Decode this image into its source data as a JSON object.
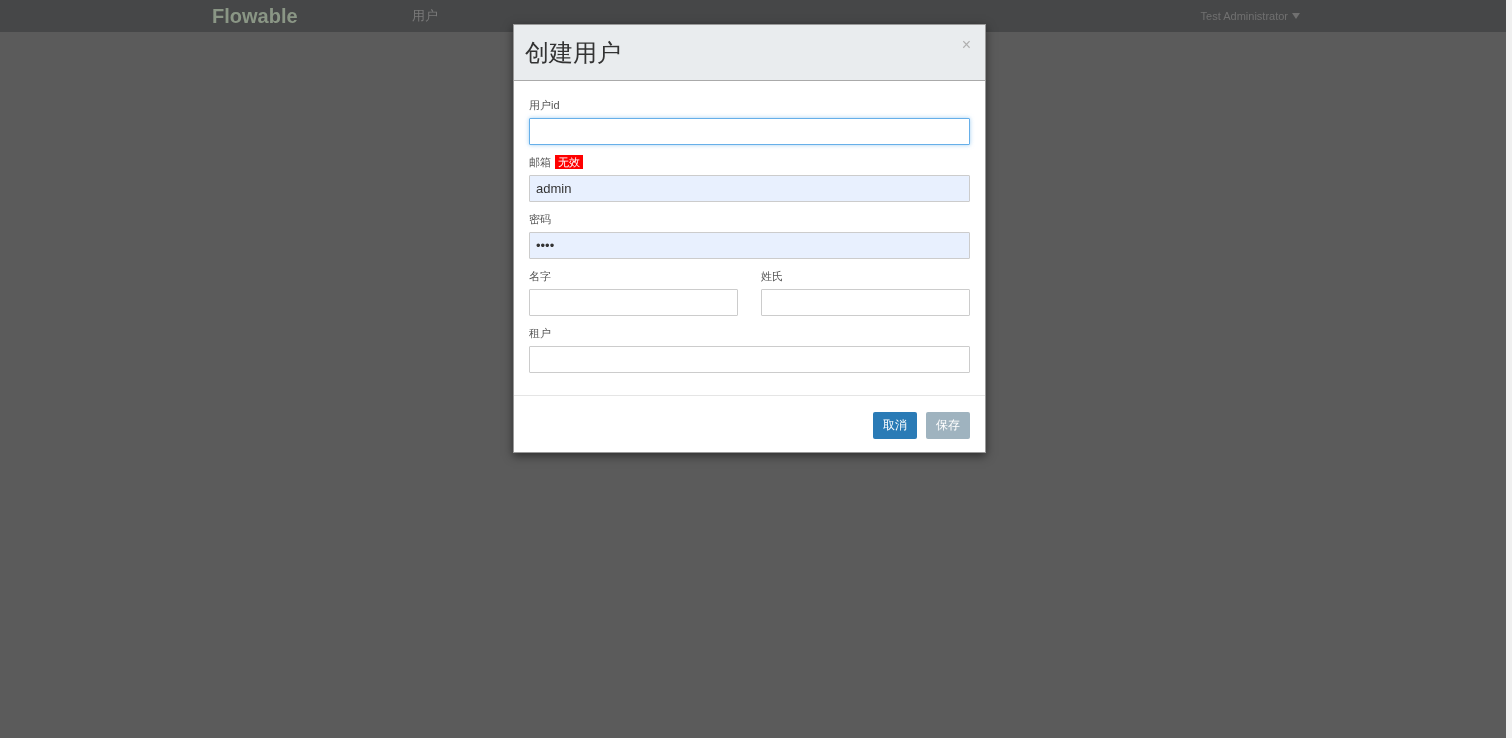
{
  "navbar": {
    "logo": "Flowable",
    "items": [
      {
        "label": "用户",
        "selected": true
      }
    ],
    "user_menu": "Test Administrator"
  },
  "dialog": {
    "title": "创建用户",
    "close": "×",
    "rows": [
      [
        {
          "label": "用户id",
          "focused": true,
          "autofilled": false
        }
      ],
      [
        {
          "label": "邮箱",
          "badge": "无效",
          "value": "admin",
          "focused": false,
          "autofilled": true
        }
      ],
      [
        {
          "label": "密码",
          "value": "••••",
          "focused": false,
          "autofilled": true
        }
      ],
      [
        {
          "label": "名字",
          "focused": false,
          "autofilled": false
        },
        {
          "label": "姓氏",
          "focused": false,
          "autofilled": false
        }
      ],
      [
        {
          "label": "租户",
          "focused": false,
          "autofilled": false
        }
      ]
    ],
    "buttons": [
      {
        "label": "取消",
        "disabled": false
      },
      {
        "label": "保存",
        "disabled": true
      }
    ]
  }
}
